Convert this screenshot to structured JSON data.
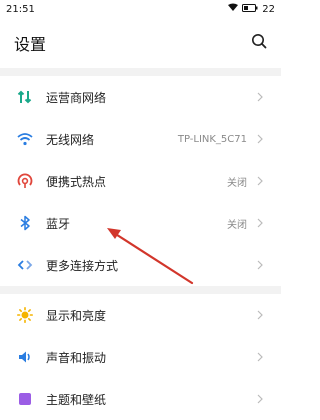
{
  "status": {
    "time": "21:51",
    "battery": "22"
  },
  "header": {
    "title": "设置"
  },
  "sections": [
    {
      "items": [
        {
          "label": "运营商网络",
          "value": "",
          "icon": "cellular-icon"
        },
        {
          "label": "无线网络",
          "value": "TP-LINK_5C71",
          "icon": "wifi-icon"
        },
        {
          "label": "便携式热点",
          "value": "关闭",
          "icon": "hotspot-icon"
        },
        {
          "label": "蓝牙",
          "value": "关闭",
          "icon": "bluetooth-icon"
        },
        {
          "label": "更多连接方式",
          "value": "",
          "icon": "link-icon"
        }
      ]
    },
    {
      "items": [
        {
          "label": "显示和亮度",
          "value": "",
          "icon": "brightness-icon"
        },
        {
          "label": "声音和振动",
          "value": "",
          "icon": "sound-icon"
        },
        {
          "label": "主题和壁纸",
          "value": "",
          "icon": "theme-icon"
        }
      ]
    }
  ]
}
